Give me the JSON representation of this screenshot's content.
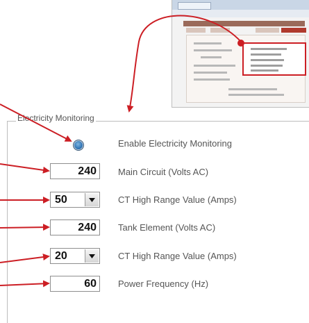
{
  "section": {
    "legend": "Electricity Monitoring"
  },
  "settings": {
    "enable": {
      "label": "Enable Electricity Monitoring",
      "selected": true
    },
    "main_circuit": {
      "value": "240",
      "label": "Main Circuit (Volts AC)"
    },
    "ct_range_1": {
      "value": "50",
      "label": "CT High Range Value (Amps)"
    },
    "tank_element": {
      "value": "240",
      "label": "Tank Element (Volts AC)"
    },
    "ct_range_2": {
      "value": "20",
      "label": "CT High Range Value (Amps)"
    },
    "power_frequency": {
      "value": "60",
      "label": "Power Frequency (Hz)"
    }
  },
  "icons": {
    "dropdown": "chevron-down-icon",
    "radio": "radio-selected-icon"
  },
  "colors": {
    "annotation_arrow": "#cc1e24",
    "radio": "#2f73b4",
    "label_text": "#555555"
  }
}
